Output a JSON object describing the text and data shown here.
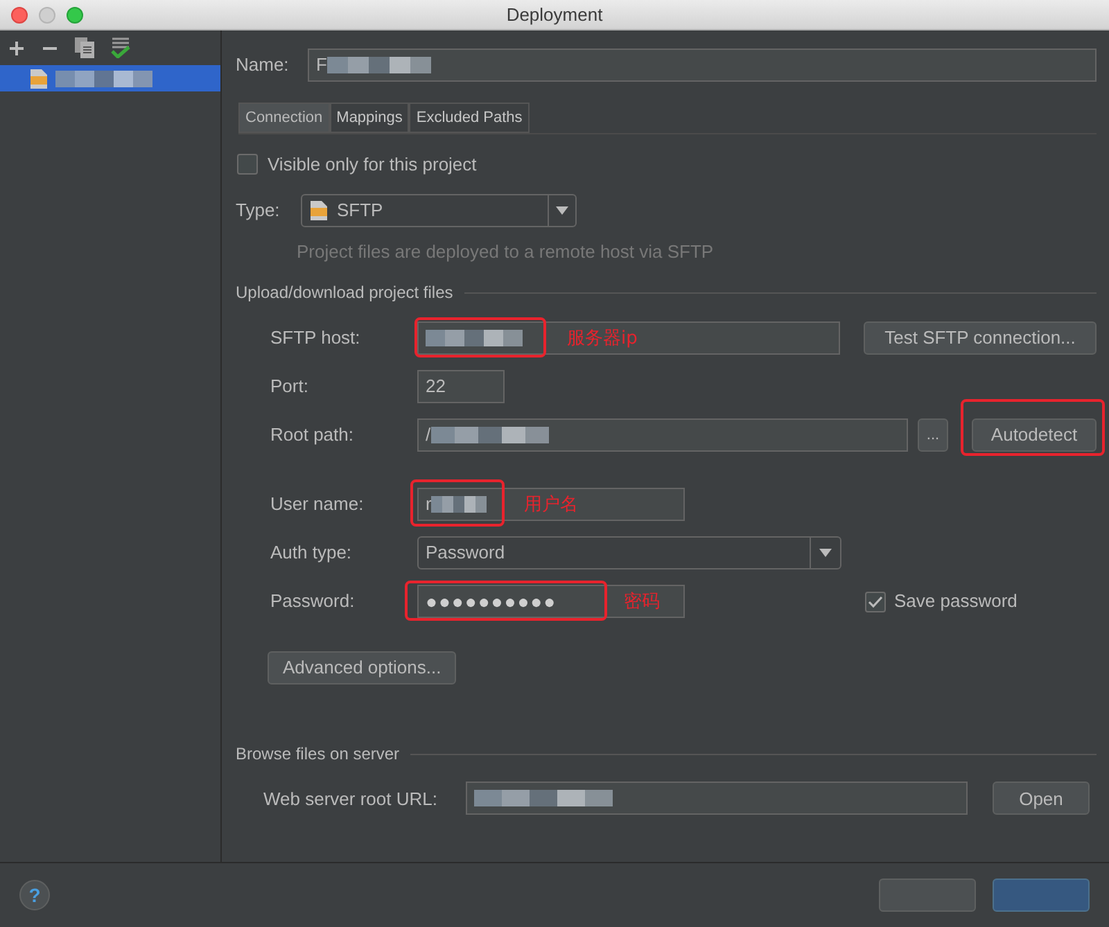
{
  "window": {
    "title": "Deployment"
  },
  "servers": [
    {
      "kind": "sftp",
      "selected": true,
      "redacted": true
    }
  ],
  "name_field": {
    "label": "Name:",
    "value": "F",
    "redacted": true
  },
  "tabs": [
    {
      "label": "Connection",
      "selected": true
    },
    {
      "label": "Mappings",
      "selected": false
    },
    {
      "label": "Excluded Paths",
      "selected": false
    }
  ],
  "visible_only": {
    "label": "Visible only for this project",
    "checked": false
  },
  "type_field": {
    "label": "Type:",
    "value": "SFTP",
    "hint": "Project files are deployed to a remote host via SFTP"
  },
  "upload_section": {
    "title": "Upload/download project files",
    "fields": [
      {
        "kind": "text",
        "label": "SFTP host:",
        "redacted": true,
        "annotation": "服务器ip",
        "buttons": [
          {
            "label": "Test SFTP connection...",
            "annotated": false
          }
        ]
      },
      {
        "kind": "text",
        "label": "Port:",
        "value": "22"
      },
      {
        "kind": "text",
        "label": "Root path:",
        "value": "/",
        "redacted": true,
        "browse": "...",
        "buttons": [
          {
            "label": "Autodetect",
            "annotated": true
          }
        ]
      },
      {
        "kind": "text",
        "label": "User name:",
        "value": "r",
        "redacted": true,
        "annotation": "用户名"
      },
      {
        "kind": "dropdown",
        "label": "Auth type:",
        "value": "Password"
      },
      {
        "kind": "password",
        "label": "Password:",
        "value": "●●●●●●●●●●",
        "annotation": "密码",
        "checkbox": {
          "label": "Save password",
          "checked": true
        }
      }
    ],
    "advanced_button": "Advanced options..."
  },
  "browse_section": {
    "title": "Browse files on server",
    "label": "Web server root URL:",
    "redacted": true,
    "button": "Open"
  },
  "footer": {
    "help": "?"
  }
}
